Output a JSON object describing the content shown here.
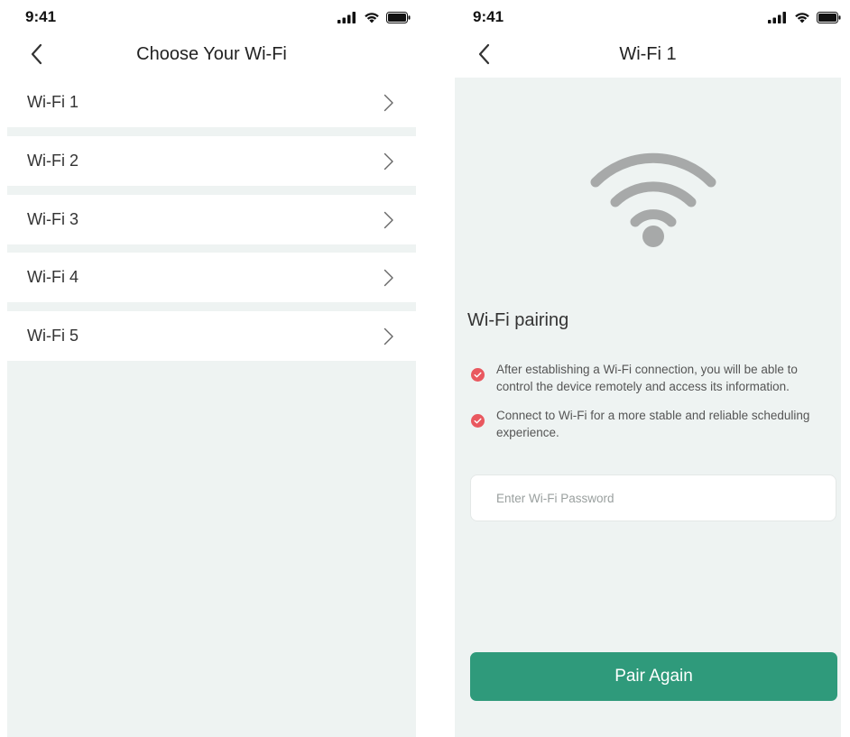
{
  "colors": {
    "accent": "#2f9a7b",
    "check": "#e9585f",
    "background": "#eef3f2",
    "wifi_icon": "#a7a9a9"
  },
  "left_screen": {
    "status_time": "9:41",
    "title": "Choose Your Wi-Fi",
    "networks": [
      {
        "label": "Wi-Fi 1"
      },
      {
        "label": "Wi-Fi 2"
      },
      {
        "label": "Wi-Fi 3"
      },
      {
        "label": "Wi-Fi 4"
      },
      {
        "label": "Wi-Fi 5"
      }
    ]
  },
  "right_screen": {
    "status_time": "9:41",
    "title": "Wi-Fi 1",
    "section_title": "Wi-Fi pairing",
    "bullets": [
      {
        "text": "After establishing a Wi-Fi connection, you will be able to control the device remotely and access its information."
      },
      {
        "text": "Connect to Wi-Fi for a more stable and reliable scheduling experience."
      }
    ],
    "password_placeholder": "Enter Wi-Fi Password",
    "pair_button_label": "Pair Again"
  }
}
